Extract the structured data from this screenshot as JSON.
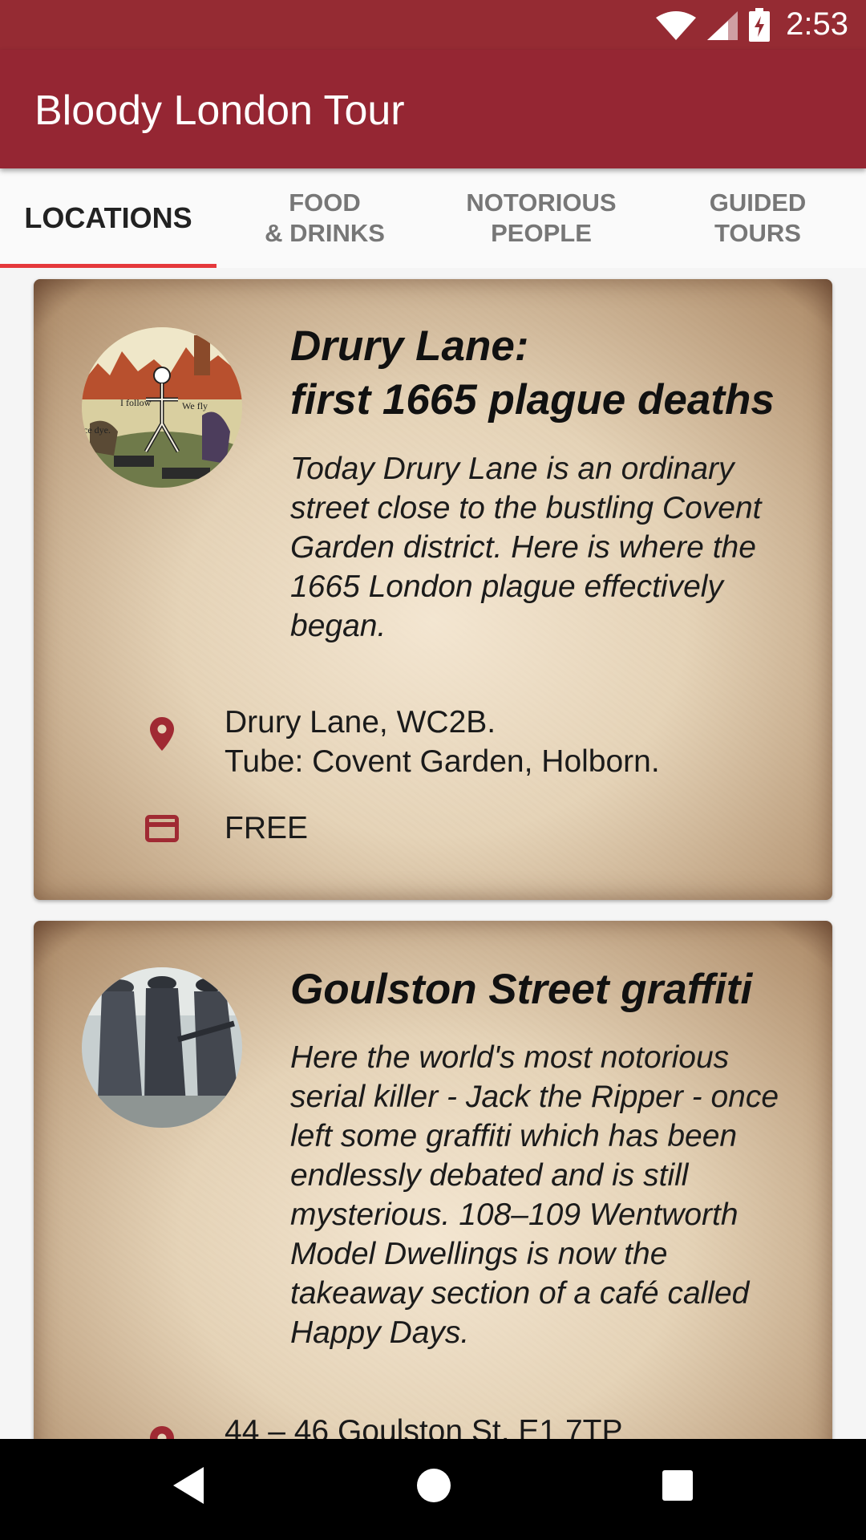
{
  "status_bar": {
    "time": "2:53"
  },
  "app_bar": {
    "title": "Bloody London Tour"
  },
  "tabs": [
    {
      "label": "LOCATIONS"
    },
    {
      "label": "FOOD\n& DRINKS"
    },
    {
      "label": "NOTORIOUS\nPEOPLE"
    },
    {
      "label": "GUIDED\nTOURS"
    }
  ],
  "cards": [
    {
      "title": "Drury Lane:\nfirst 1665 plague deaths",
      "description": "Today Drury Lane is an ordinary street close to the bustling Covent Garden district. Here is where the 1665 London plague effectively began.",
      "address": "Drury Lane, WC2B.\nTube: Covent Garden, Holborn.",
      "price": "FREE",
      "image_captions": [
        "I follow",
        "We fly",
        "ce dye."
      ]
    },
    {
      "title": "Goulston Street graffiti",
      "description": "Here the world's most notorious serial killer - Jack the Ripper - once left some graffiti which has been endlessly debated and is still mysterious. 108–109 Wentworth Model Dwellings is now the takeaway section of a café called Happy Days.",
      "address": "44 – 46 Goulston St, E1 7TP"
    }
  ],
  "colors": {
    "primary": "#952633",
    "status": "#952b33",
    "accent": "#e5383b",
    "icon": "#a02a33"
  }
}
